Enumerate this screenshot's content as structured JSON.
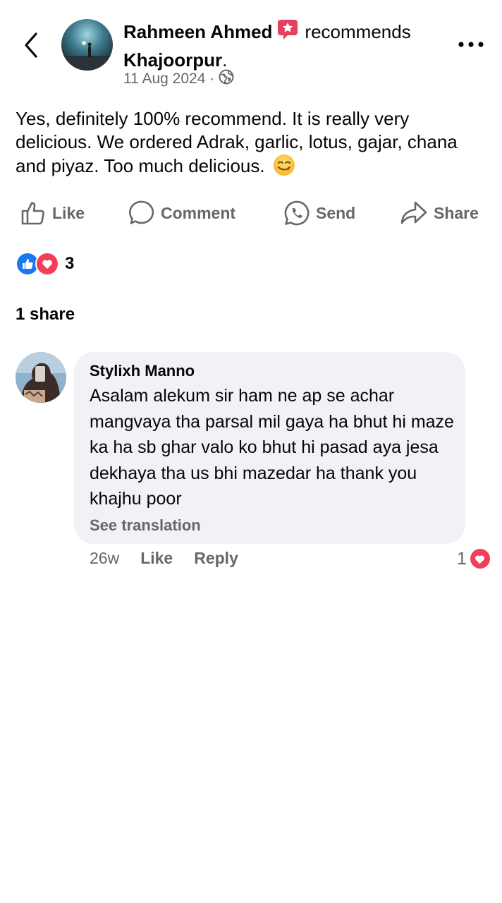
{
  "post": {
    "author": "Rahmeen Ahmed",
    "recommends_label": "recommends",
    "place": "Khajoorpur",
    "period": ".",
    "date": "11 Aug 2024",
    "separator": "·",
    "body": "Yes, definitely 100% recommend. It is really very delicious. We ordered Adrak, garlic, lotus, gajar, chana and piyaz. Too much delicious.",
    "emoji": "😋"
  },
  "actions": {
    "like": "Like",
    "comment": "Comment",
    "send": "Send",
    "share": "Share"
  },
  "reactions": {
    "count": "3"
  },
  "shares": {
    "label": "1 share"
  },
  "comment": {
    "author": "Stylixh Manno",
    "text": "Asalam alekum sir ham ne ap se achar mangvaya tha parsal mil gaya ha bhut hi maze ka ha sb ghar valo ko bhut hi pasad aya jesa dekhaya tha us bhi mazedar ha thank you khajhu poor",
    "see_translation": "See translation",
    "time": "26w",
    "like": "Like",
    "reply": "Reply",
    "reaction_count": "1"
  },
  "colors": {
    "text": "#050505",
    "secondary": "#65676b",
    "bubble": "#f0f2f5",
    "like_blue": "#1877f2",
    "love_red": "#f33e58",
    "badge_pink": "#e4405f"
  }
}
